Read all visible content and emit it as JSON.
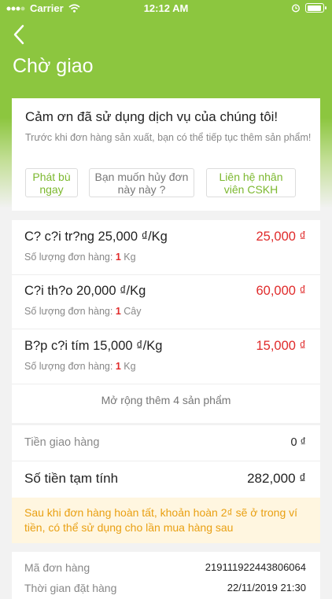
{
  "status_bar": {
    "carrier": "Carrier",
    "time": "12:12 AM"
  },
  "header": {
    "title": "Chờ giao"
  },
  "thanks_card": {
    "title": "Cảm ơn đã sử dụng dịch vụ của chúng tôi!",
    "subtitle": "Trước khi đơn hàng sản xuất, bạn có thể tiếp tục thêm sản phẩm!",
    "buttons": {
      "add_more": "Phát bù ngay",
      "cancel": "Bạn muốn hủy đơn này này ?",
      "contact": "Liên hệ nhân viên CSKH"
    }
  },
  "products": {
    "qty_label": "Số lượng đơn hàng: ",
    "items": [
      {
        "name": "C? c?i tr?ng 25,000 ₫/Kg",
        "qty": "1",
        "unit": " Kg",
        "price": "25,000 ₫"
      },
      {
        "name": "C?i th?o 20,000 ₫/Kg",
        "qty": "1",
        "unit": " Cây",
        "price": "60,000 ₫"
      },
      {
        "name": "B?p c?i tím 15,000 ₫/Kg",
        "qty": "1",
        "unit": " Kg",
        "price": "15,000 ₫"
      }
    ],
    "expand_label": "Mở rộng thêm 4 sản phẩm"
  },
  "summary": {
    "shipping_label": "Tiền giao hàng",
    "shipping_value": "0 ₫",
    "total_label": "Số tiền tạm tính",
    "total_value": "282,000 ₫",
    "notice": "Sau khi đơn hàng hoàn tất, khoản hoàn 2₫ sẽ ở trong ví tiền, có thể sử dụng cho lần mua hàng sau"
  },
  "order_info": {
    "code_label": "Mã đơn hàng",
    "code_value": "219111922443806064",
    "time_label": "Thời gian đặt hàng",
    "time_value": "22/11/2019 21:30"
  },
  "colors": {
    "brand": "#8cc63f",
    "accent_green": "#7cb82f",
    "price_red": "#e02b2b",
    "notice_orange": "#e9a013",
    "notice_bg": "#fff6e0"
  },
  "icons": {
    "back": "chevron-left-icon",
    "wifi": "wifi-icon",
    "battery": "battery-icon",
    "signal": "signal-dots-icon"
  }
}
